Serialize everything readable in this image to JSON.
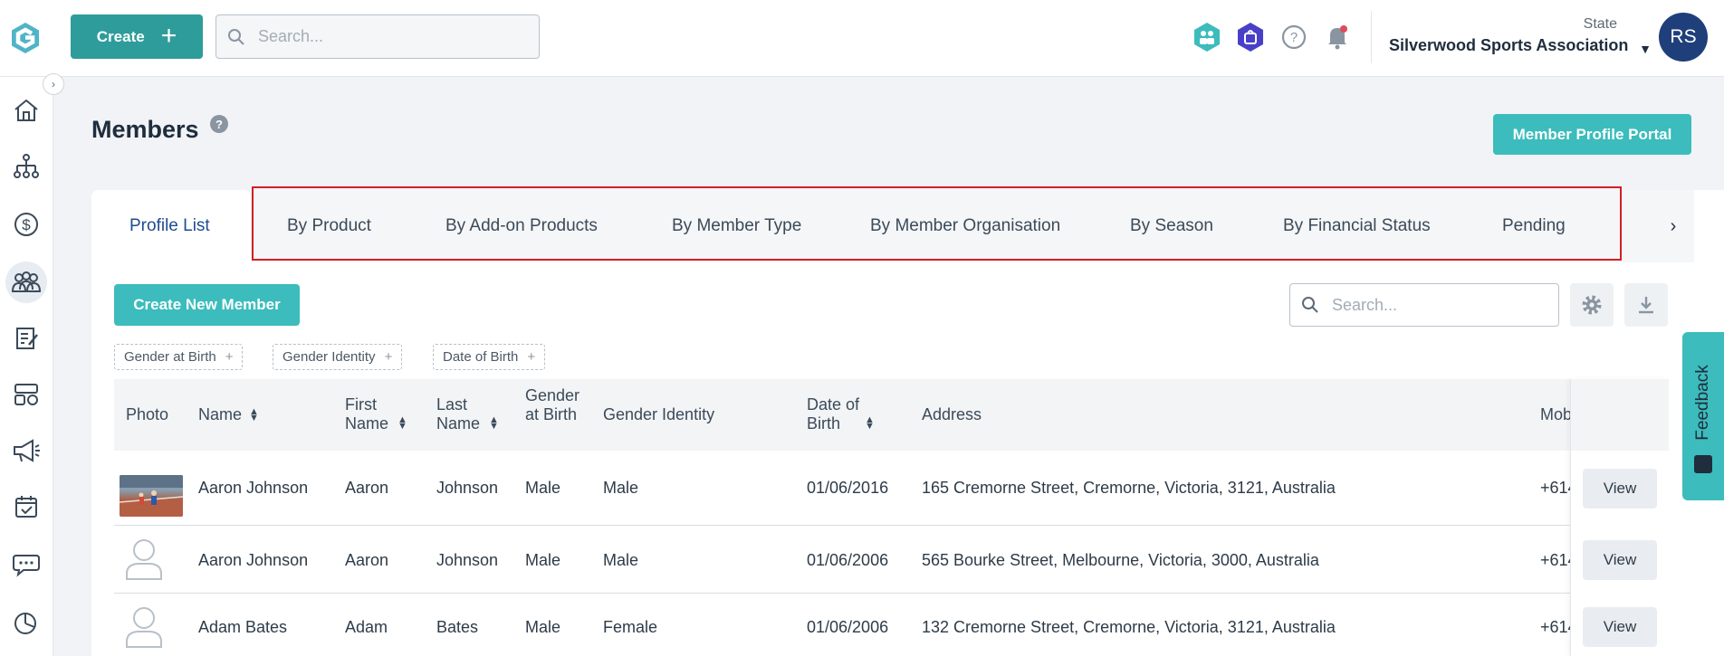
{
  "topbar": {
    "create_label": "Create",
    "search_placeholder": "Search...",
    "org_state": "State",
    "org_name": "Silverwood Sports Association",
    "avatar_initials": "RS",
    "icons": [
      "people-hex-icon",
      "shop-hex-icon",
      "help-circle-icon",
      "bell-icon"
    ]
  },
  "sidebar": {
    "items": [
      "home-icon",
      "org-chart-icon",
      "dollar-icon",
      "members-icon",
      "form-icon",
      "competition-icon",
      "megaphone-icon",
      "calendar-check-icon",
      "chat-icon",
      "pie-chart-icon"
    ],
    "active": "members-icon"
  },
  "page": {
    "title": "Members",
    "help": "?",
    "portal_button": "Member Profile Portal"
  },
  "tabs": {
    "items": [
      "Profile List",
      "By Product",
      "By Add-on Products",
      "By Member Type",
      "By Member Organisation",
      "By Season",
      "By Financial Status",
      "Pending"
    ],
    "active": "Profile List"
  },
  "toolbar": {
    "new_member_label": "Create New Member",
    "search_placeholder": "Search..."
  },
  "filters": [
    "Gender at Birth",
    "Gender Identity",
    "Date of Birth"
  ],
  "table": {
    "columns": {
      "photo": "Photo",
      "name": "Name",
      "first_name": "First Name",
      "last_name": "Last Name",
      "gender_birth": "Gender at Birth",
      "gender_identity": "Gender Identity",
      "dob": "Date of Birth",
      "address": "Address",
      "mobile": "Mob"
    },
    "rows": [
      {
        "name": "Aaron Johnson",
        "first": "Aaron",
        "last": "Johnson",
        "gender_birth": "Male",
        "gender_identity": "Male",
        "dob": "01/06/2016",
        "address": "165 Cremorne Street, Cremorne, Victoria, 3121, Australia",
        "mobile": "+614",
        "action": "View"
      },
      {
        "name": "Aaron Johnson",
        "first": "Aaron",
        "last": "Johnson",
        "gender_birth": "Male",
        "gender_identity": "Male",
        "dob": "01/06/2006",
        "address": "565 Bourke Street, Melbourne, Victoria, 3000, Australia",
        "mobile": "+614",
        "action": "View"
      },
      {
        "name": "Adam Bates",
        "first": "Adam",
        "last": "Bates",
        "gender_birth": "Male",
        "gender_identity": "Female",
        "dob": "01/06/2006",
        "address": "132 Cremorne Street, Cremorne, Victoria, 3121, Australia",
        "mobile": "+614",
        "action": "View"
      }
    ]
  },
  "feedback": {
    "label": "Feedback"
  },
  "colors": {
    "teal": "#3cbcbc",
    "teal_dark": "#2f9c9c",
    "highlight": "#d21f26",
    "avatar": "#1f3f7a"
  }
}
